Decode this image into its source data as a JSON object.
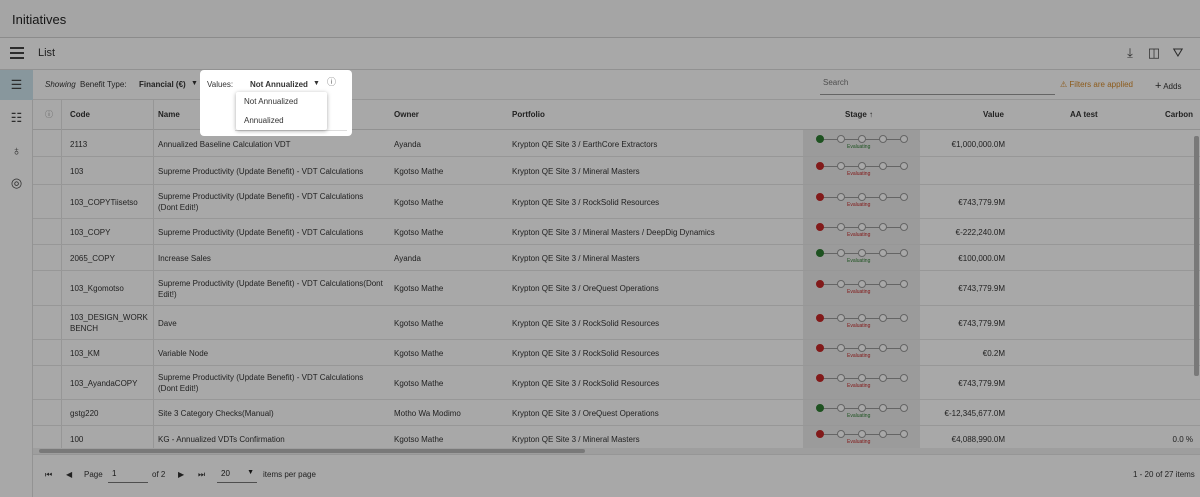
{
  "page_title": "Initiatives",
  "toolbar": {
    "list_title": "List"
  },
  "filterbar": {
    "showing_label": "Showing",
    "benefit_type_label": "Benefit Type:",
    "benefit_type_value": "Financial (€)",
    "values_label": "Values:",
    "values_value": "Not Annualized",
    "search_placeholder": "Search",
    "filters_applied": "Filters are applied",
    "adds_label": "Adds"
  },
  "values_dropdown": {
    "options": [
      "Not Annualized",
      "Annualized"
    ]
  },
  "columns": {
    "code": "Code",
    "name": "Name",
    "owner": "Owner",
    "portfolio": "Portfolio",
    "stage": "Stage",
    "value": "Value",
    "aa_test": "AA test",
    "carbon": "Carbon"
  },
  "rows": [
    {
      "code": "2113",
      "name": "Annualized Baseline Calculation VDT",
      "owner": "Ayanda",
      "portfolio": "Krypton QE Site 3 / EarthCore Extractors",
      "stage_color": "green",
      "stage_label": "Evaluating",
      "value": "€1,000,000.0M"
    },
    {
      "code": "103",
      "name": "Supreme Productivity (Update Benefit) - VDT Calculations",
      "owner": "Kgotso Mathe",
      "portfolio": "Krypton QE Site 3 / Mineral Masters",
      "stage_color": "red",
      "stage_label": "Evaluating",
      "value": ""
    },
    {
      "code": "103_COPYTiisetso",
      "name": "Supreme Productivity (Update Benefit) - VDT Calculations (Dont Edit!)",
      "owner": "Kgotso Mathe",
      "portfolio": "Krypton QE Site 3 / RockSolid Resources",
      "stage_color": "red",
      "stage_label": "Evaluating",
      "value": "€743,779.9M"
    },
    {
      "code": "103_COPY",
      "name": "Supreme Productivity (Update Benefit) - VDT Calculations",
      "owner": "Kgotso Mathe",
      "portfolio": "Krypton QE Site 3 / Mineral Masters / DeepDig Dynamics",
      "stage_color": "red",
      "stage_label": "Evaluating",
      "value": "€-222,240.0M"
    },
    {
      "code": "2065_COPY",
      "name": "Increase Sales",
      "owner": "Ayanda",
      "portfolio": "Krypton QE Site 3 / Mineral Masters",
      "stage_color": "green",
      "stage_label": "Evaluating",
      "value": "€100,000.0M"
    },
    {
      "code": "103_Kgomotso",
      "name": "Supreme Productivity (Update Benefit) - VDT Calculations(Dont Edit!)",
      "owner": "Kgotso Mathe",
      "portfolio": "Krypton QE Site 3 / OreQuest Operations",
      "stage_color": "red",
      "stage_label": "Evaluating",
      "value": "€743,779.9M"
    },
    {
      "code": "103_DESIGN_WORK BENCH",
      "name": "Dave",
      "owner": "Kgotso Mathe",
      "portfolio": "Krypton QE Site 3 / RockSolid Resources",
      "stage_color": "red",
      "stage_label": "Evaluating",
      "value": "€743,779.9M"
    },
    {
      "code": "103_KM",
      "name": "Variable Node",
      "owner": "Kgotso Mathe",
      "portfolio": "Krypton QE Site 3 / RockSolid Resources",
      "stage_color": "red",
      "stage_label": "Evaluating",
      "value": "€0.2M"
    },
    {
      "code": "103_AyandaCOPY",
      "name": "Supreme Productivity (Update Benefit) - VDT Calculations (Dont Edit!)",
      "owner": "Kgotso Mathe",
      "portfolio": "Krypton QE Site 3 / RockSolid Resources",
      "stage_color": "red",
      "stage_label": "Evaluating",
      "value": "€743,779.9M"
    },
    {
      "code": "gstg220",
      "name": "Site 3 Category Checks(Manual)",
      "owner": "Motho Wa Modimo",
      "portfolio": "Krypton QE Site 3 / OreQuest Operations",
      "stage_color": "green",
      "stage_label": "Evaluating",
      "value": "€-12,345,677.0M"
    },
    {
      "code": "100",
      "name": "KG - Annualized VDTs Confirmation",
      "owner": "Kgotso Mathe",
      "portfolio": "Krypton QE Site 3 / Mineral Masters",
      "stage_color": "red",
      "stage_label": "Evaluating",
      "value": "€4,088,990.0M",
      "carbon": "0.0 %"
    }
  ],
  "pager": {
    "page_label": "Page",
    "page_value": "1",
    "of_label": "of 2",
    "per_page_value": "20",
    "items_per_page_label": "items per page",
    "range_label": "1 - 20 of 27 items"
  },
  "colors": {
    "accent": "#cfe6ef",
    "warning": "#d58a2a",
    "stage_red": "#c62828",
    "stage_green": "#2e7d32"
  }
}
